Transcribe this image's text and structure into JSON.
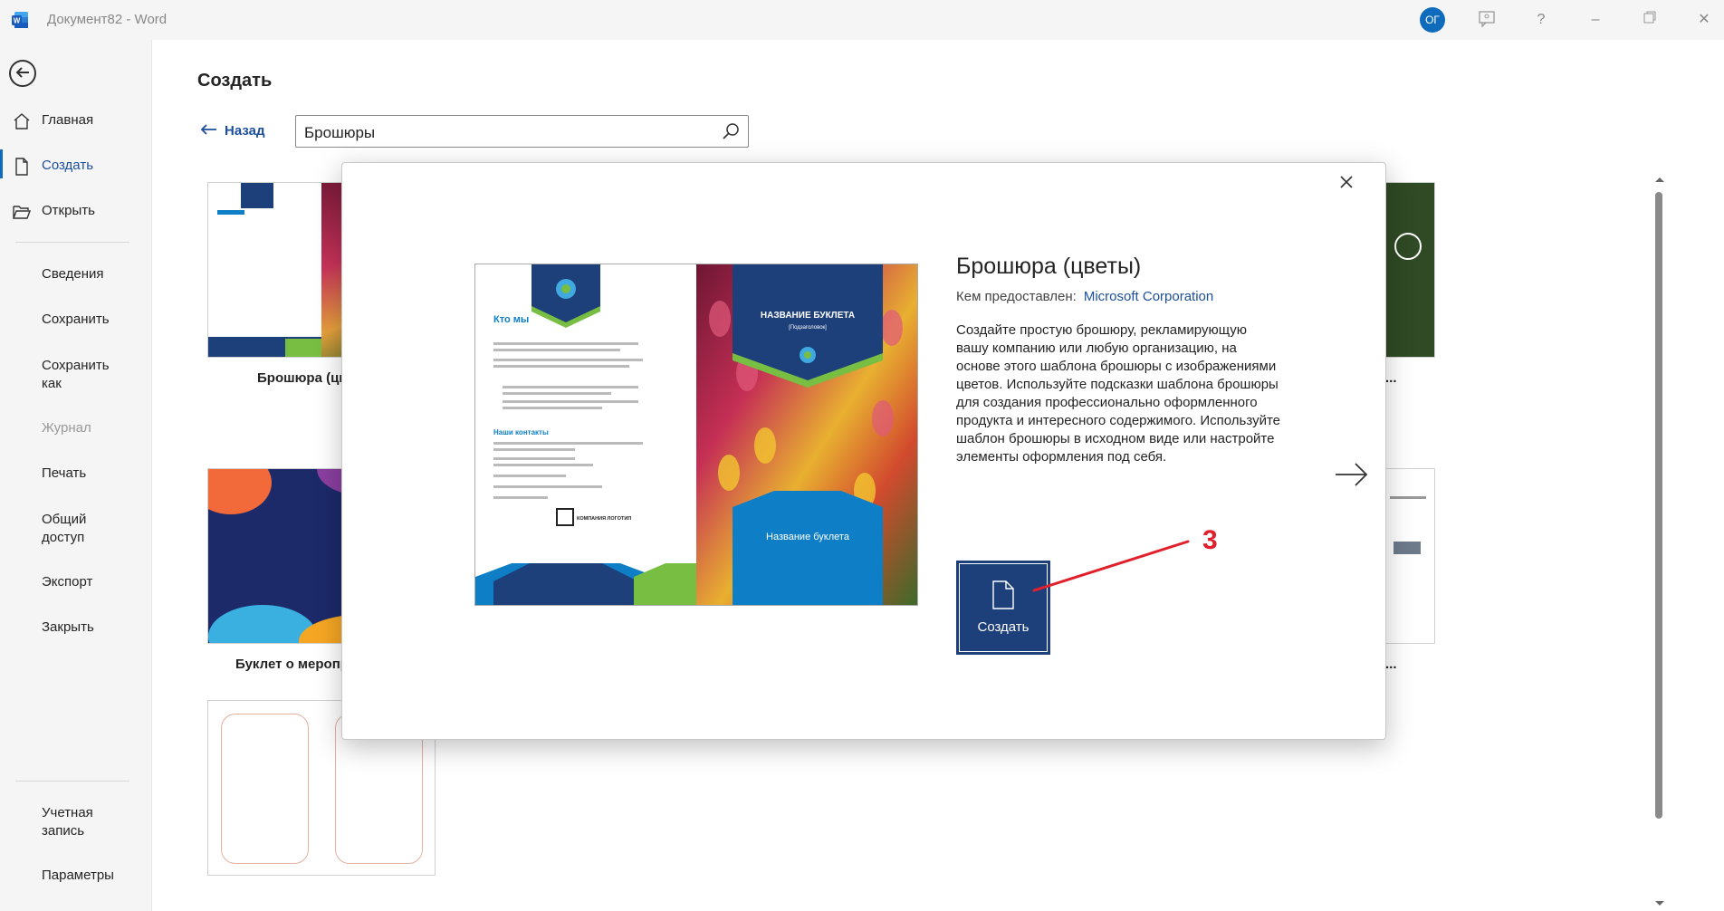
{
  "window": {
    "title": "Документ82  -  Word",
    "avatar_initials": "ОГ"
  },
  "titlebar_icons": [
    "feedback-icon",
    "help-icon",
    "minimize-icon",
    "restore-icon",
    "close-icon"
  ],
  "sidebar": {
    "items": [
      {
        "label": "Главная",
        "icon": "home-icon"
      },
      {
        "label": "Создать",
        "icon": "new-document-icon",
        "selected": true
      },
      {
        "label": "Открыть",
        "icon": "folder-open-icon"
      },
      {
        "label": "Сведения"
      },
      {
        "label": "Сохранить"
      },
      {
        "label": "Сохранить как"
      },
      {
        "label": "Журнал",
        "disabled": true
      },
      {
        "label": "Печать"
      },
      {
        "label": "Общий доступ"
      },
      {
        "label": "Экспорт"
      },
      {
        "label": "Закрыть"
      }
    ],
    "bottom": [
      {
        "label": "Учетная запись"
      },
      {
        "label": "Параметры"
      }
    ]
  },
  "main": {
    "title": "Создать",
    "back_label": "Назад",
    "search": {
      "value": "Брошюры"
    },
    "templates": [
      {
        "label": "Брошюра (цветы)"
      },
      {
        "label": "Буклет о мероприятии"
      },
      {
        "label": "..."
      },
      {
        "label": "..."
      }
    ]
  },
  "modal": {
    "title": "Брошюра (цветы)",
    "provided_by_label": "Кем предоставлен:",
    "provider": "Microsoft Corporation",
    "description": "Создайте простую брошюру, рекламирующую вашу компанию или любую организацию, на основе этого шаблона брошюры с изображениями цветов. Используйте подсказки шаблона брошюры для создания профессионально оформленного продукта и интересного содержимого. Используйте шаблон брошюры в исходном виде или настройте элементы оформления под себя.",
    "create_label": "Создать",
    "preview": {
      "heading": "Кто мы",
      "booklet_title": "НАЗВАНИЕ БУКЛЕТА",
      "booklet_subtitle": "[Подзаголовок]",
      "booklet_name": "Название буклета",
      "contacts_heading": "Наши контакты",
      "logo_text": "КОМПАНИЯ ЛОГОТИП"
    }
  },
  "annotation": {
    "number": "3",
    "color": "#e0202a"
  },
  "colors": {
    "accent": "#0f6cbd",
    "dark_blue": "#1d3f7a",
    "brochure_blue": "#0e7fc6",
    "brochure_green": "#78be43"
  }
}
